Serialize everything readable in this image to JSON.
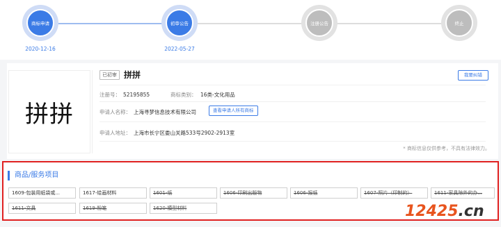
{
  "timeline": {
    "steps": [
      {
        "label": "商标申请",
        "state": "active",
        "date": "2020-12-16"
      },
      {
        "label": "初审公告",
        "state": "active",
        "date": "2022-05-27"
      },
      {
        "label": "注册公告",
        "state": "inactive",
        "date": ""
      },
      {
        "label": "终止",
        "state": "inactive",
        "date": ""
      }
    ],
    "colors": {
      "active": "#3b7be6",
      "active_ring": "#cfdcf6",
      "inactive": "#bdbdbd",
      "line_active": "#9ebcf0",
      "line_inactive": "#dddddd"
    }
  },
  "trademark": {
    "image_text": "拼拼",
    "status": "已初审",
    "name": "拼拼",
    "report_button": "我要纠错",
    "reg_no_label": "注册号：",
    "reg_no": "52195855",
    "category_label": "商标类别：",
    "category": "16类-文化用品",
    "applicant_label": "申请人名称：",
    "applicant": "上海寻梦信息技术有限公司",
    "view_all_button": "查看申请人所有商标",
    "address_label": "申请人地址：",
    "address": "上海市长宁区娄山关路533号2902-2913室",
    "disclaimer": "* 商标信息仅供参考，不具有法律效力。"
  },
  "goods": {
    "title": "商品/服务项目",
    "items": [
      {
        "text": "1609-包装用纸袋或...",
        "struck": false
      },
      {
        "text": "1617-绘画材料",
        "struck": false
      },
      {
        "text": "1601-纸",
        "struck": true
      },
      {
        "text": "1606-印刷出版物",
        "struck": true
      },
      {
        "text": "1606-报纸",
        "struck": true
      },
      {
        "text": "1607-照片（印制的）",
        "struck": true
      },
      {
        "text": "1611-家具除外的办...",
        "struck": true
      },
      {
        "text": "1611-文具",
        "struck": true
      },
      {
        "text": "1619-粉笔",
        "struck": true
      },
      {
        "text": "1620-模型材料",
        "struck": true
      }
    ]
  },
  "watermark": {
    "number": "12425",
    "suffix": ".cn"
  }
}
